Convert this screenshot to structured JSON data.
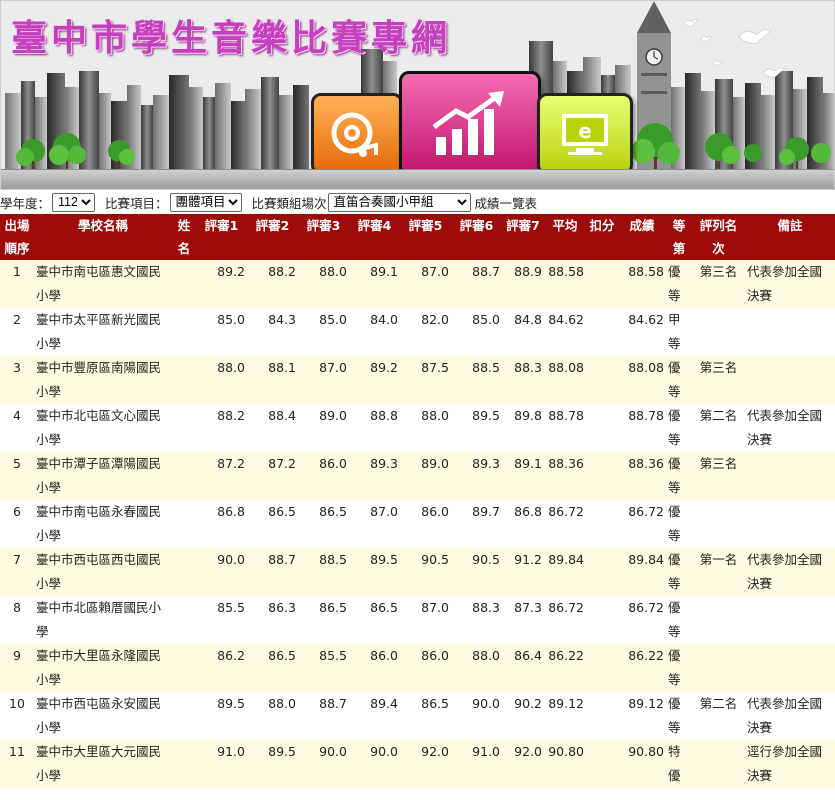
{
  "banner": {
    "title": "臺中市學生音樂比賽專網",
    "icons": [
      "cd-music-icon",
      "growth-chart-icon",
      "monitor-e-icon"
    ]
  },
  "filters": {
    "year_label": "學年度：",
    "year_value": "112",
    "item_label": "比賽項目：",
    "item_value": "團體項目",
    "group_label": "比賽類組場次",
    "group_value": "直笛合奏國小甲組",
    "result_label": "成績一覽表"
  },
  "table": {
    "headers": {
      "seq": "出場順序",
      "school": "學校名稱",
      "name": "姓名",
      "j1": "評審1",
      "j2": "評審2",
      "j3": "評審3",
      "j4": "評審4",
      "j5": "評審5",
      "j6": "評審6",
      "j7": "評審7",
      "avg": "平均",
      "deduct": "扣分",
      "score": "成績",
      "grade": "等第",
      "rank": "評列名次",
      "note": "備註"
    },
    "rows": [
      {
        "seq": "1",
        "school": "臺中市南屯區惠文國民小學",
        "name": "",
        "j1": "89.2",
        "j2": "88.2",
        "j3": "88.0",
        "j4": "89.1",
        "j5": "87.0",
        "j6": "88.7",
        "j7": "88.9",
        "avg": "88.58",
        "deduct": "",
        "score": "88.58",
        "grade": "優等",
        "rank": "第三名",
        "note": "代表參加全國決賽"
      },
      {
        "seq": "2",
        "school": "臺中市太平區新光國民小學",
        "name": "",
        "j1": "85.0",
        "j2": "84.3",
        "j3": "85.0",
        "j4": "84.0",
        "j5": "82.0",
        "j6": "85.0",
        "j7": "84.8",
        "avg": "84.62",
        "deduct": "",
        "score": "84.62",
        "grade": "甲等",
        "rank": "",
        "note": ""
      },
      {
        "seq": "3",
        "school": "臺中市豐原區南陽國民小學",
        "name": "",
        "j1": "88.0",
        "j2": "88.1",
        "j3": "87.0",
        "j4": "89.2",
        "j5": "87.5",
        "j6": "88.5",
        "j7": "88.3",
        "avg": "88.08",
        "deduct": "",
        "score": "88.08",
        "grade": "優等",
        "rank": "第三名",
        "note": ""
      },
      {
        "seq": "4",
        "school": "臺中市北屯區文心國民小學",
        "name": "",
        "j1": "88.2",
        "j2": "88.4",
        "j3": "89.0",
        "j4": "88.8",
        "j5": "88.0",
        "j6": "89.5",
        "j7": "89.8",
        "avg": "88.78",
        "deduct": "",
        "score": "88.78",
        "grade": "優等",
        "rank": "第二名",
        "note": "代表參加全國決賽"
      },
      {
        "seq": "5",
        "school": "臺中市潭子區潭陽國民小學",
        "name": "",
        "j1": "87.2",
        "j2": "87.2",
        "j3": "86.0",
        "j4": "89.3",
        "j5": "89.0",
        "j6": "89.3",
        "j7": "89.1",
        "avg": "88.36",
        "deduct": "",
        "score": "88.36",
        "grade": "優等",
        "rank": "第三名",
        "note": ""
      },
      {
        "seq": "6",
        "school": "臺中市南屯區永春國民小學",
        "name": "",
        "j1": "86.8",
        "j2": "86.5",
        "j3": "86.5",
        "j4": "87.0",
        "j5": "86.0",
        "j6": "89.7",
        "j7": "86.8",
        "avg": "86.72",
        "deduct": "",
        "score": "86.72",
        "grade": "優等",
        "rank": "",
        "note": ""
      },
      {
        "seq": "7",
        "school": "臺中市西屯區西屯國民小學",
        "name": "",
        "j1": "90.0",
        "j2": "88.7",
        "j3": "88.5",
        "j4": "89.5",
        "j5": "90.5",
        "j6": "90.5",
        "j7": "91.2",
        "avg": "89.84",
        "deduct": "",
        "score": "89.84",
        "grade": "優等",
        "rank": "第一名",
        "note": "代表參加全國決賽"
      },
      {
        "seq": "8",
        "school": "臺中市北區賴厝國民小學",
        "name": "",
        "j1": "85.5",
        "j2": "86.3",
        "j3": "86.5",
        "j4": "86.5",
        "j5": "87.0",
        "j6": "88.3",
        "j7": "87.3",
        "avg": "86.72",
        "deduct": "",
        "score": "86.72",
        "grade": "優等",
        "rank": "",
        "note": ""
      },
      {
        "seq": "9",
        "school": "臺中市大里區永隆國民小學",
        "name": "",
        "j1": "86.2",
        "j2": "86.5",
        "j3": "85.5",
        "j4": "86.0",
        "j5": "86.0",
        "j6": "88.0",
        "j7": "86.4",
        "avg": "86.22",
        "deduct": "",
        "score": "86.22",
        "grade": "優等",
        "rank": "",
        "note": ""
      },
      {
        "seq": "10",
        "school": "臺中市西屯區永安國民小學",
        "name": "",
        "j1": "89.5",
        "j2": "88.0",
        "j3": "88.7",
        "j4": "89.4",
        "j5": "86.5",
        "j6": "90.0",
        "j7": "90.2",
        "avg": "89.12",
        "deduct": "",
        "score": "89.12",
        "grade": "優等",
        "rank": "第二名",
        "note": "代表參加全國決賽"
      },
      {
        "seq": "11",
        "school": "臺中市大里區大元國民小學",
        "name": "",
        "j1": "91.0",
        "j2": "89.5",
        "j3": "90.0",
        "j4": "90.0",
        "j5": "92.0",
        "j6": "91.0",
        "j7": "92.0",
        "avg": "90.80",
        "deduct": "",
        "score": "90.80",
        "grade": "特優",
        "rank": "",
        "note": "逕行參加全國決賽"
      }
    ]
  }
}
